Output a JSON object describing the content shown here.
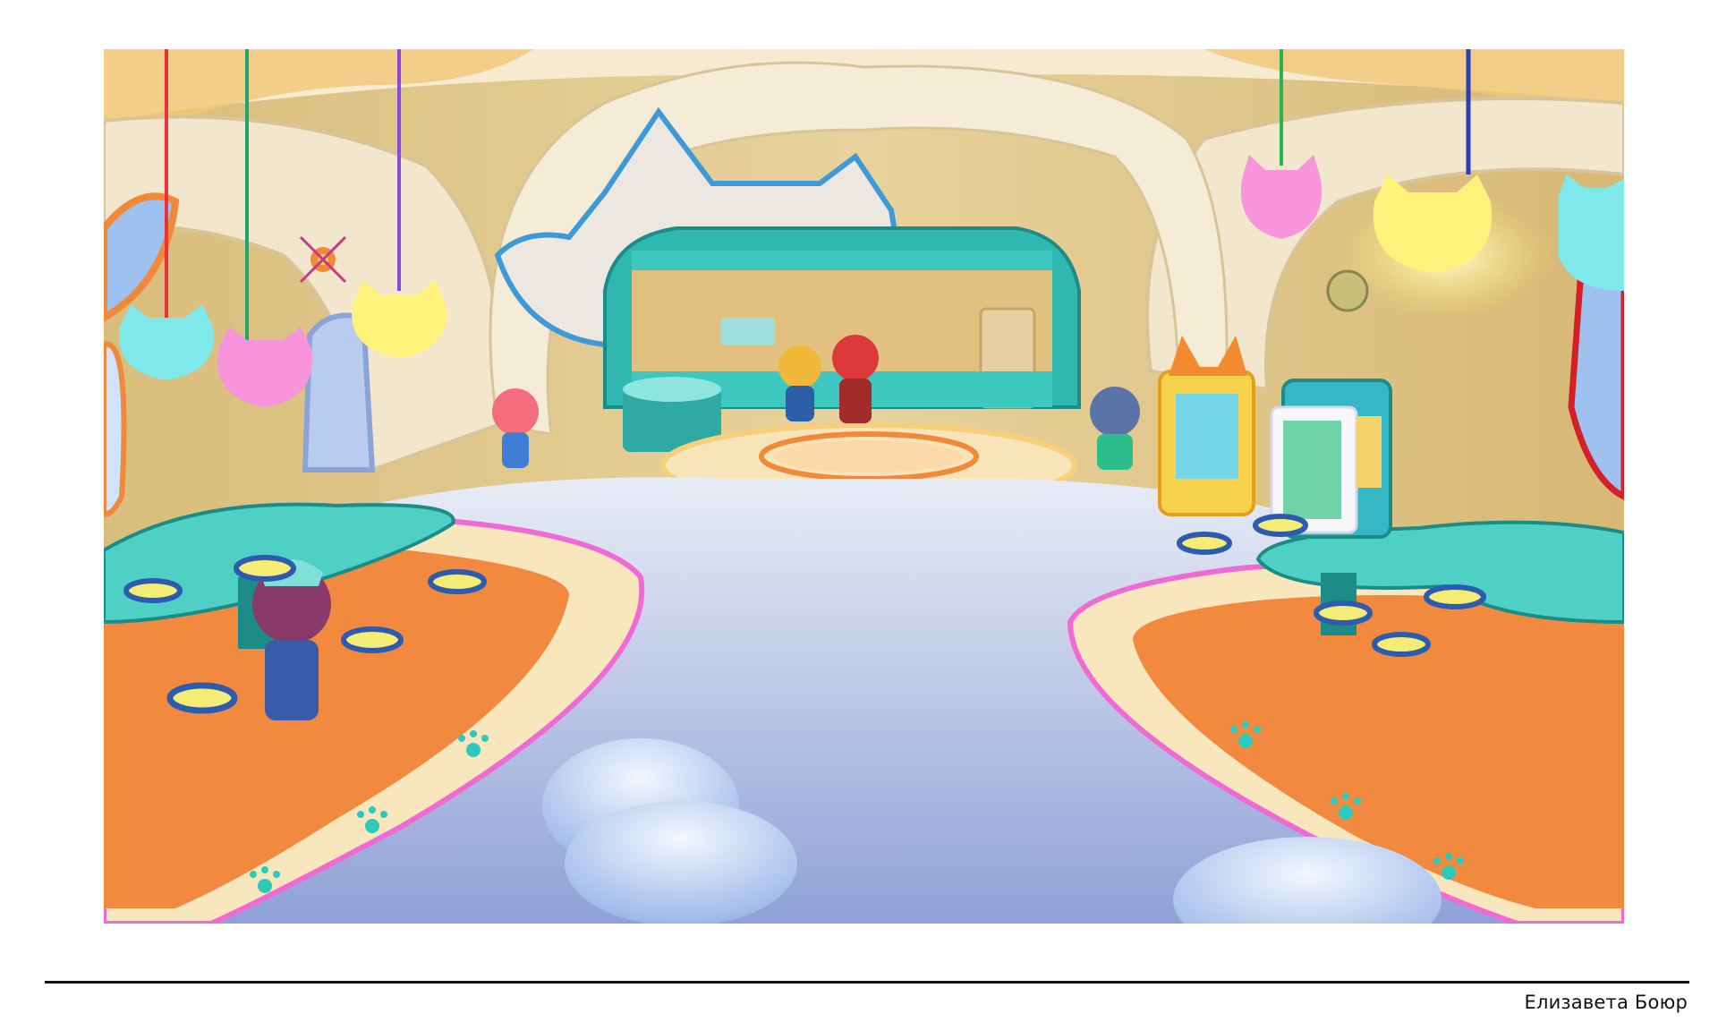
{
  "author": "Елизавета Боюр",
  "colors": {
    "page_background": "#ffffff",
    "rule": "#111111",
    "wall": "#e3c98d",
    "floor": "#c9d2ea",
    "teal": "#2fb7b0",
    "orange": "#f18a3f",
    "pink_lamp": "#f48ad6",
    "cyan_lamp": "#6fe6e6",
    "yellow_lamp": "#fff07a"
  },
  "icons": [
    "cat-lamp-icon",
    "paw-print-icon",
    "arrows-target-icon",
    "vending-machine-icon",
    "kitchen-counter-icon"
  ]
}
